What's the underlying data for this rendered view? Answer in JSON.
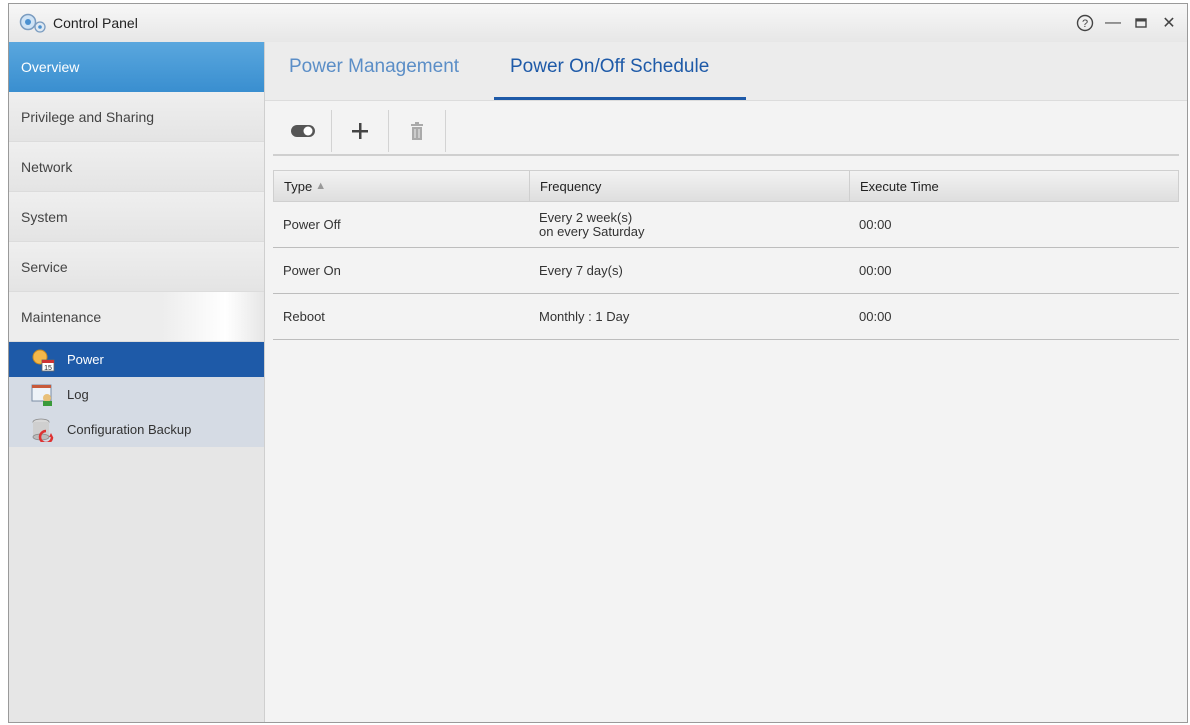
{
  "window": {
    "title": "Control Panel"
  },
  "titlebar": {
    "help_symbol": "?",
    "minimize_symbol": "—",
    "maximize_symbol": "□",
    "close_symbol": "✕"
  },
  "sidebar": {
    "items": [
      {
        "label": "Overview"
      },
      {
        "label": "Privilege and Sharing"
      },
      {
        "label": "Network"
      },
      {
        "label": "System"
      },
      {
        "label": "Service"
      },
      {
        "label": "Maintenance"
      }
    ],
    "sub_items": [
      {
        "label": "Power",
        "icon": "power-schedule-icon"
      },
      {
        "label": "Log",
        "icon": "log-icon"
      },
      {
        "label": "Configuration Backup",
        "icon": "database-backup-icon"
      }
    ]
  },
  "tabs": [
    {
      "label": "Power Management"
    },
    {
      "label": "Power On/Off Schedule"
    }
  ],
  "toolbar": {
    "icons": [
      "toggle-icon",
      "add-icon",
      "delete-icon"
    ]
  },
  "table": {
    "headers": {
      "type": "Type",
      "frequency": "Frequency",
      "execute_time": "Execute Time"
    },
    "sort_indicator": "▲",
    "rows": [
      {
        "type": "Power Off",
        "frequency_line1": "Every 2 week(s)",
        "frequency_line2": "on every Saturday",
        "time": "00:00"
      },
      {
        "type": "Power On",
        "frequency_line1": "Every 7 day(s)",
        "frequency_line2": "",
        "time": "00:00"
      },
      {
        "type": "Reboot",
        "frequency_line1": "Monthly : 1 Day",
        "frequency_line2": "",
        "time": "00:00"
      }
    ]
  },
  "colors": {
    "accent": "#1e5aa8",
    "sidebar_active": "#3a8fd0"
  }
}
